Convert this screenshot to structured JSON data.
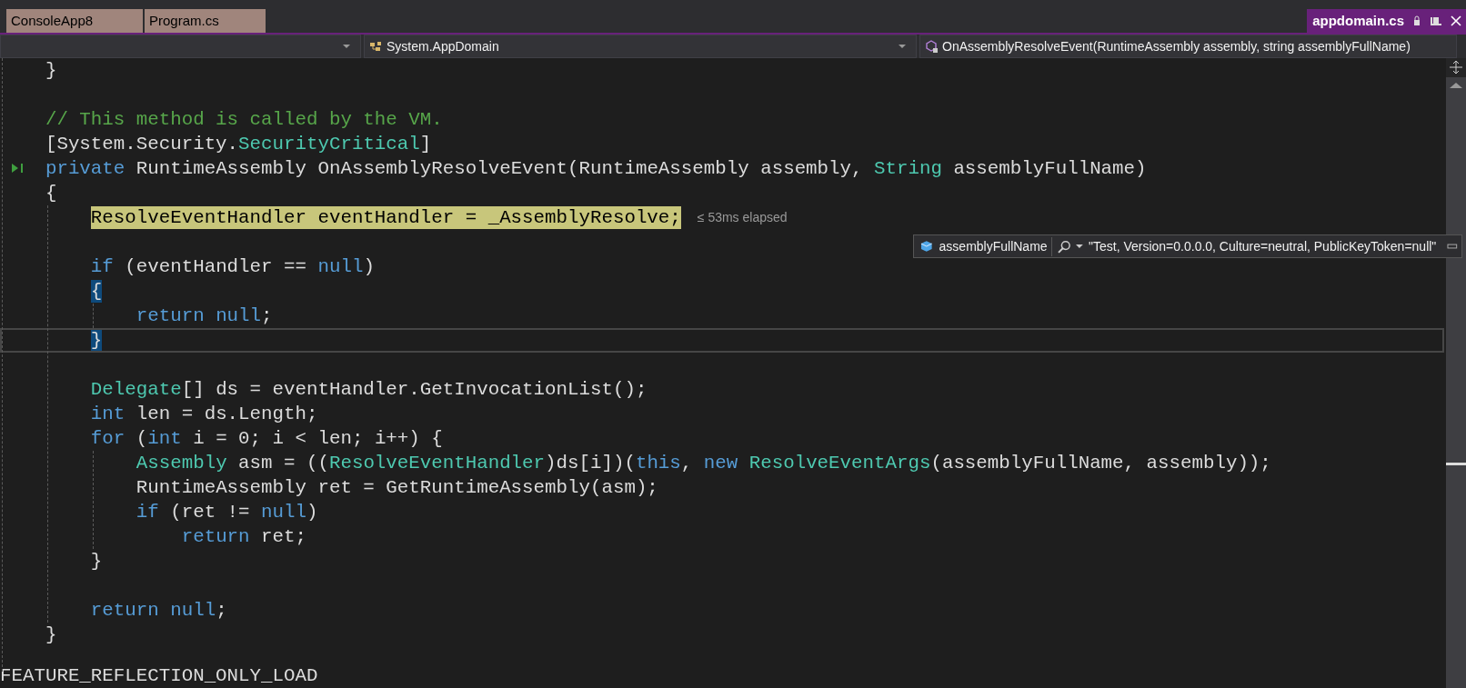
{
  "tabs": [
    {
      "label": "ConsoleApp8",
      "selected": false
    },
    {
      "label": "Program.cs",
      "selected": false
    },
    {
      "label": "appdomain.cs",
      "selected": true
    }
  ],
  "nav_bar": {
    "dropdown_2": "System.AppDomain",
    "dropdown_3": "OnAssemblyResolveEvent(RuntimeAssembly assembly, string assemblyFullName)"
  },
  "code_lines": [
    {
      "kind": "code",
      "tokens": [
        {
          "kind": "plain",
          "text": "    }"
        }
      ]
    },
    {
      "kind": "blank"
    },
    {
      "kind": "code",
      "tokens": [
        {
          "kind": "comment",
          "text": "    // This method is called by the VM."
        }
      ]
    },
    {
      "kind": "code",
      "tokens": [
        {
          "kind": "plain",
          "text": "    [System.Security."
        },
        {
          "kind": "type",
          "text": "SecurityCritical"
        },
        {
          "kind": "plain",
          "text": "]"
        }
      ]
    },
    {
      "kind": "code",
      "run_to_click": true,
      "tokens": [
        {
          "kind": "keyword",
          "text": "    private"
        },
        {
          "kind": "plain",
          "text": " RuntimeAssembly OnAssemblyResolveEvent(RuntimeAssembly assembly, "
        },
        {
          "kind": "type",
          "text": "String"
        },
        {
          "kind": "plain",
          "text": " assemblyFullName)"
        }
      ]
    },
    {
      "kind": "code",
      "tokens": [
        {
          "kind": "plain",
          "text": "    {"
        }
      ]
    },
    {
      "kind": "code",
      "perf_tip": "≤ 53ms elapsed",
      "tokens": [
        {
          "kind": "current",
          "text": "        ResolveEventHandler eventHandler = _AssemblyResolve;"
        }
      ]
    },
    {
      "kind": "blank"
    },
    {
      "kind": "code",
      "tokens": [
        {
          "kind": "keyword",
          "text": "        if"
        },
        {
          "kind": "plain",
          "text": " (eventHandler == "
        },
        {
          "kind": "keyword",
          "text": "null"
        },
        {
          "kind": "plain",
          "text": ")"
        }
      ]
    },
    {
      "kind": "code",
      "tokens": [
        {
          "kind": "brace-match",
          "text": "        {"
        }
      ]
    },
    {
      "kind": "code",
      "tokens": [
        {
          "kind": "keyword",
          "text": "            return"
        },
        {
          "kind": "keyword",
          "text": " null"
        },
        {
          "kind": "plain",
          "text": ";"
        }
      ]
    },
    {
      "kind": "caret-line",
      "tokens": [
        {
          "kind": "brace-match",
          "text": "        }"
        }
      ]
    },
    {
      "kind": "blank"
    },
    {
      "kind": "code",
      "tokens": [
        {
          "kind": "type",
          "text": "        Delegate"
        },
        {
          "kind": "plain",
          "text": "[] ds = eventHandler.GetInvocationList();"
        }
      ]
    },
    {
      "kind": "code",
      "tokens": [
        {
          "kind": "keyword",
          "text": "        int"
        },
        {
          "kind": "plain",
          "text": " len = ds.Length;"
        }
      ]
    },
    {
      "kind": "code",
      "tokens": [
        {
          "kind": "keyword",
          "text": "        for"
        },
        {
          "kind": "plain",
          "text": " ("
        },
        {
          "kind": "keyword",
          "text": "int"
        },
        {
          "kind": "plain",
          "text": " i = 0; i < len; i++) {"
        }
      ]
    },
    {
      "kind": "code",
      "tokens": [
        {
          "kind": "type",
          "text": "            Assembly"
        },
        {
          "kind": "plain",
          "text": " asm = (("
        },
        {
          "kind": "type",
          "text": "ResolveEventHandler"
        },
        {
          "kind": "plain",
          "text": ")ds[i])("
        },
        {
          "kind": "keyword",
          "text": "this"
        },
        {
          "kind": "plain",
          "text": ", "
        },
        {
          "kind": "keyword",
          "text": "new"
        },
        {
          "kind": "type",
          "text": " ResolveEventArgs"
        },
        {
          "kind": "plain",
          "text": "(assemblyFullName, assembly));"
        }
      ]
    },
    {
      "kind": "code",
      "tokens": [
        {
          "kind": "plain",
          "text": "            RuntimeAssembly ret = GetRuntimeAssembly(asm);"
        }
      ]
    },
    {
      "kind": "code",
      "tokens": [
        {
          "kind": "keyword",
          "text": "            if"
        },
        {
          "kind": "plain",
          "text": " (ret != "
        },
        {
          "kind": "keyword",
          "text": "null"
        },
        {
          "kind": "plain",
          "text": ")"
        }
      ]
    },
    {
      "kind": "code",
      "tokens": [
        {
          "kind": "keyword",
          "text": "                return"
        },
        {
          "kind": "plain",
          "text": " ret;"
        }
      ]
    },
    {
      "kind": "code",
      "tokens": [
        {
          "kind": "plain",
          "text": "        }"
        }
      ]
    },
    {
      "kind": "blank"
    },
    {
      "kind": "code",
      "tokens": [
        {
          "kind": "keyword",
          "text": "        return"
        },
        {
          "kind": "keyword",
          "text": " null"
        },
        {
          "kind": "plain",
          "text": ";"
        }
      ]
    },
    {
      "kind": "code",
      "tokens": [
        {
          "kind": "plain",
          "text": "    }"
        }
      ]
    },
    {
      "kind": "directive",
      "tokens": [
        {
          "kind": "plain",
          "text": "FEATURE_REFLECTION_ONLY_LOAD"
        }
      ]
    }
  ],
  "datatip": {
    "name": "assemblyFullName",
    "value": "\"Test, Version=0.0.0.0, Culture=neutral, PublicKeyToken=null\""
  }
}
